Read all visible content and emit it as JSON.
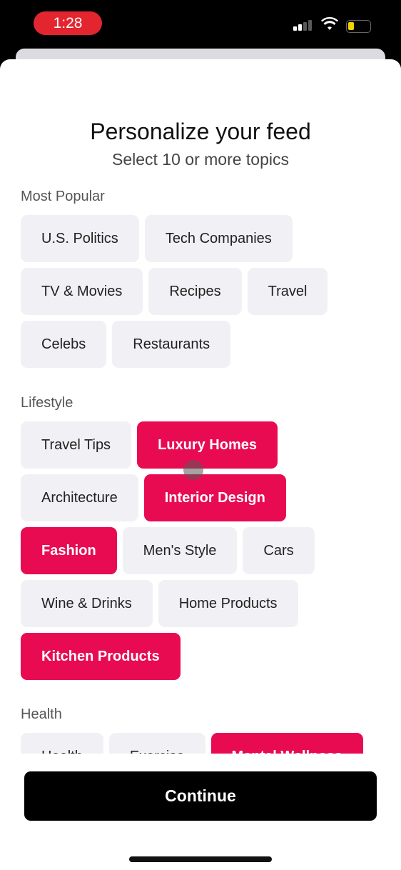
{
  "status_bar": {
    "time": "1:28",
    "battery_color": "#f2d200"
  },
  "header": {
    "title": "Personalize your feed",
    "subtitle": "Select 10 or more topics"
  },
  "accent_color": "#e80b52",
  "sections": [
    {
      "title": "Most Popular",
      "topics": [
        {
          "label": "U.S. Politics",
          "selected": false
        },
        {
          "label": "Tech Companies",
          "selected": false
        },
        {
          "label": "TV & Movies",
          "selected": false
        },
        {
          "label": "Recipes",
          "selected": false
        },
        {
          "label": "Travel",
          "selected": false
        },
        {
          "label": "Celebs",
          "selected": false
        },
        {
          "label": "Restaurants",
          "selected": false
        }
      ]
    },
    {
      "title": "Lifestyle",
      "topics": [
        {
          "label": "Travel Tips",
          "selected": false
        },
        {
          "label": "Luxury Homes",
          "selected": true
        },
        {
          "label": "Architecture",
          "selected": false
        },
        {
          "label": "Interior Design",
          "selected": true
        },
        {
          "label": "Fashion",
          "selected": true
        },
        {
          "label": "Men's Style",
          "selected": false
        },
        {
          "label": "Cars",
          "selected": false
        },
        {
          "label": "Wine & Drinks",
          "selected": false
        },
        {
          "label": "Home Products",
          "selected": false
        },
        {
          "label": "Kitchen Products",
          "selected": true
        }
      ]
    },
    {
      "title": "Health",
      "topics": [
        {
          "label": "Health",
          "selected": false
        },
        {
          "label": "Exercise",
          "selected": false
        },
        {
          "label": "Mental Wellness",
          "selected": true
        }
      ]
    }
  ],
  "continue_label": "Continue"
}
